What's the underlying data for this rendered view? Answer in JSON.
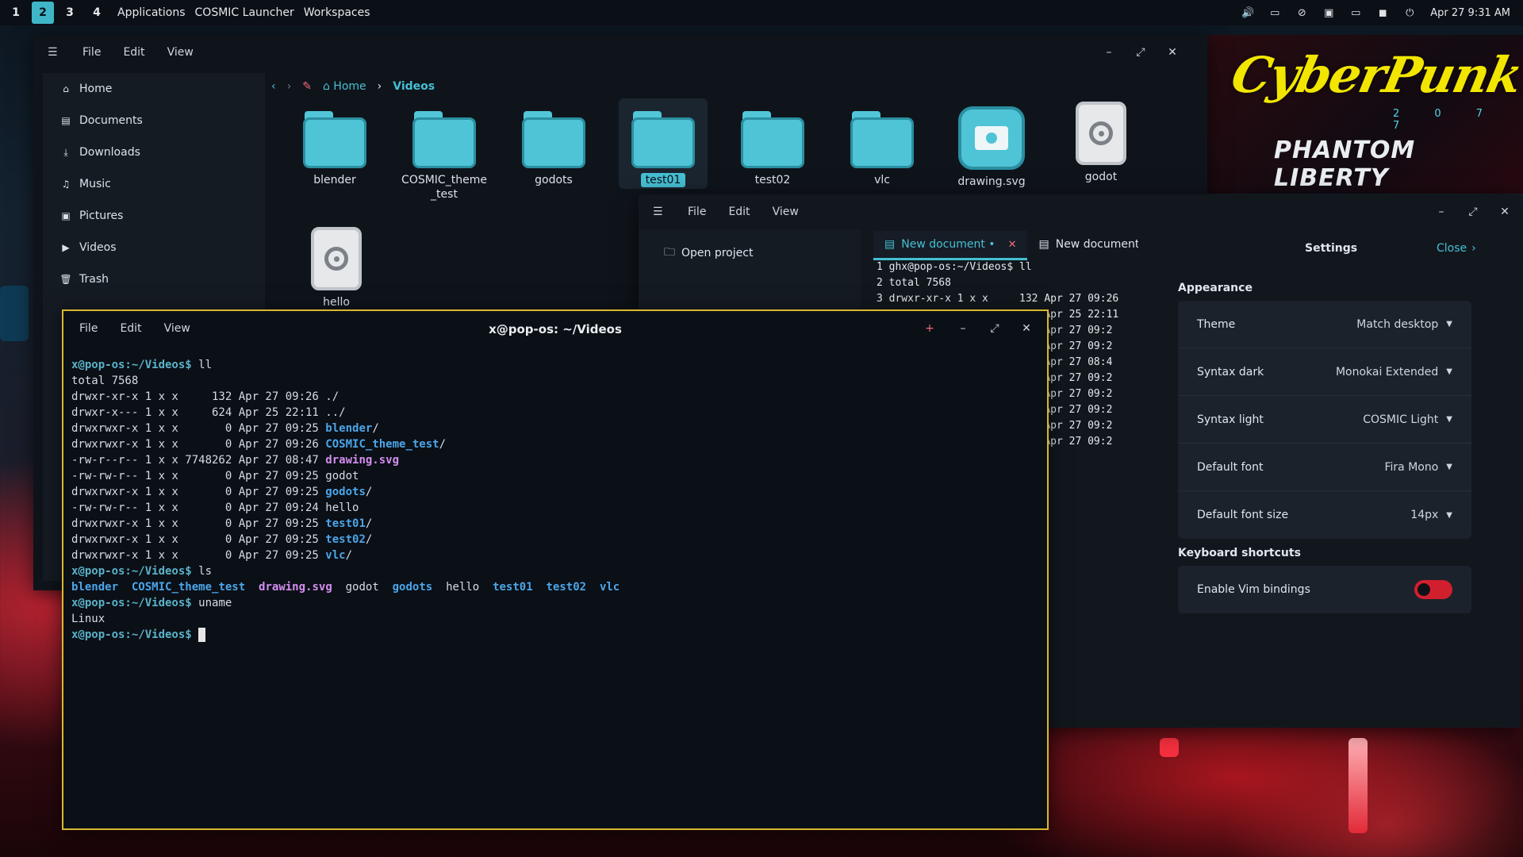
{
  "panel": {
    "workspaces": [
      "1",
      "2",
      "3",
      "4"
    ],
    "active_workspace": "2",
    "links": [
      "Applications",
      "COSMIC Launcher",
      "Workspaces"
    ],
    "clock": "Apr 27 9:31 AM",
    "tray_icons": [
      "volume-icon",
      "screen-icon",
      "notifications-off-icon",
      "display-icon",
      "battery-icon",
      "chat-icon",
      "power-icon"
    ]
  },
  "wallpaper": {
    "title": "CyberPunk",
    "year": "2 0 7 7",
    "subtitle": "PHANTOM LIBERTY"
  },
  "files": {
    "menu": [
      "File",
      "Edit",
      "View"
    ],
    "sidebar": [
      "Home",
      "Documents",
      "Downloads",
      "Music",
      "Pictures",
      "Videos",
      "Trash"
    ],
    "breadcrumb": {
      "home": "Home",
      "current": "Videos"
    },
    "items": [
      {
        "name": "blender",
        "kind": "folder"
      },
      {
        "name": "COSMIC_theme_test",
        "kind": "folder"
      },
      {
        "name": "godots",
        "kind": "folder"
      },
      {
        "name": "test01",
        "kind": "folder",
        "selected": true
      },
      {
        "name": "test02",
        "kind": "folder"
      },
      {
        "name": "vlc",
        "kind": "folder"
      },
      {
        "name": "drawing.svg",
        "kind": "image"
      },
      {
        "name": "godot",
        "kind": "file"
      },
      {
        "name": "hello",
        "kind": "file"
      }
    ]
  },
  "editor": {
    "menu": [
      "File",
      "Edit",
      "View"
    ],
    "open_project": "Open project",
    "tabs": [
      {
        "label": "New document •",
        "active": true
      },
      {
        "label": "New document",
        "active": false
      }
    ],
    "code_lines": [
      "1 ghx@pop-os:~/Videos$ ll",
      "2 total 7568",
      "3 drwxr-xr-x 1 x x     132 Apr 27 09:26",
      "                       624 Apr 25 22:11",
      "                         0 Apr 27 09:2",
      "                         0 Apr 27 09:2",
      "                         2 Apr 27 08:4",
      "                         0 Apr 27 09:2",
      "                         0 Apr 27 09:2",
      "                         0 Apr 27 09:2",
      "                         0 Apr 27 09:2",
      "                         0 Apr 27 09:2"
    ],
    "settings": {
      "title": "Settings",
      "close": "Close",
      "appearance_heading": "Appearance",
      "rows": [
        {
          "label": "Theme",
          "value": "Match desktop"
        },
        {
          "label": "Syntax dark",
          "value": "Monokai Extended"
        },
        {
          "label": "Syntax light",
          "value": "COSMIC Light"
        },
        {
          "label": "Default font",
          "value": "Fira Mono"
        },
        {
          "label": "Default font size",
          "value": "14px"
        }
      ],
      "keyboard_heading": "Keyboard shortcuts",
      "vim_label": "Enable Vim bindings",
      "vim_enabled": true
    }
  },
  "terminal": {
    "title": "x@pop-os: ~/Videos",
    "menu": [
      "File",
      "Edit",
      "View"
    ],
    "prompt": "x@pop-os:~/Videos$",
    "ll_command": "ll",
    "total": "total 7568",
    "listing": [
      {
        "meta": "drwxr-xr-x 1 x x     132 Apr 27 09:26 ",
        "name": "./",
        "type": "plain"
      },
      {
        "meta": "drwxr-x--- 1 x x     624 Apr 25 22:11 ",
        "name": "../",
        "type": "plain"
      },
      {
        "meta": "drwxrwxr-x 1 x x       0 Apr 27 09:25 ",
        "name": "blender",
        "type": "dir"
      },
      {
        "meta": "drwxrwxr-x 1 x x       0 Apr 27 09:26 ",
        "name": "COSMIC_theme_test",
        "type": "dir"
      },
      {
        "meta": "-rw-r--r-- 1 x x 7748262 Apr 27 08:47 ",
        "name": "drawing.svg",
        "type": "svg"
      },
      {
        "meta": "-rw-rw-r-- 1 x x       0 Apr 27 09:25 ",
        "name": "godot",
        "type": "plain"
      },
      {
        "meta": "drwxrwxr-x 1 x x       0 Apr 27 09:25 ",
        "name": "godots",
        "type": "dir"
      },
      {
        "meta": "-rw-rw-r-- 1 x x       0 Apr 27 09:24 ",
        "name": "hello",
        "type": "plain"
      },
      {
        "meta": "drwxrwxr-x 1 x x       0 Apr 27 09:25 ",
        "name": "test01",
        "type": "dir"
      },
      {
        "meta": "drwxrwxr-x 1 x x       0 Apr 27 09:25 ",
        "name": "test02",
        "type": "dir"
      },
      {
        "meta": "drwxrwxr-x 1 x x       0 Apr 27 09:25 ",
        "name": "vlc",
        "type": "dir"
      }
    ],
    "ls_command": "ls",
    "ls_output": [
      {
        "name": "blender",
        "type": "dir"
      },
      {
        "name": "COSMIC_theme_test",
        "type": "dir"
      },
      {
        "name": "drawing.svg",
        "type": "svg"
      },
      {
        "name": "godot",
        "type": "plain"
      },
      {
        "name": "godots",
        "type": "dir"
      },
      {
        "name": "hello",
        "type": "plain"
      },
      {
        "name": "test01",
        "type": "dir"
      },
      {
        "name": "test02",
        "type": "dir"
      },
      {
        "name": "vlc",
        "type": "dir"
      }
    ],
    "uname_command": "uname",
    "uname_output": "Linux"
  },
  "colors": {
    "accent": "#46bfd2",
    "terminal_border": "#d9b92e",
    "toggle_on": "#d21f2e",
    "dir_color": "#4aa6ea",
    "svg_color": "#d38ef0"
  }
}
